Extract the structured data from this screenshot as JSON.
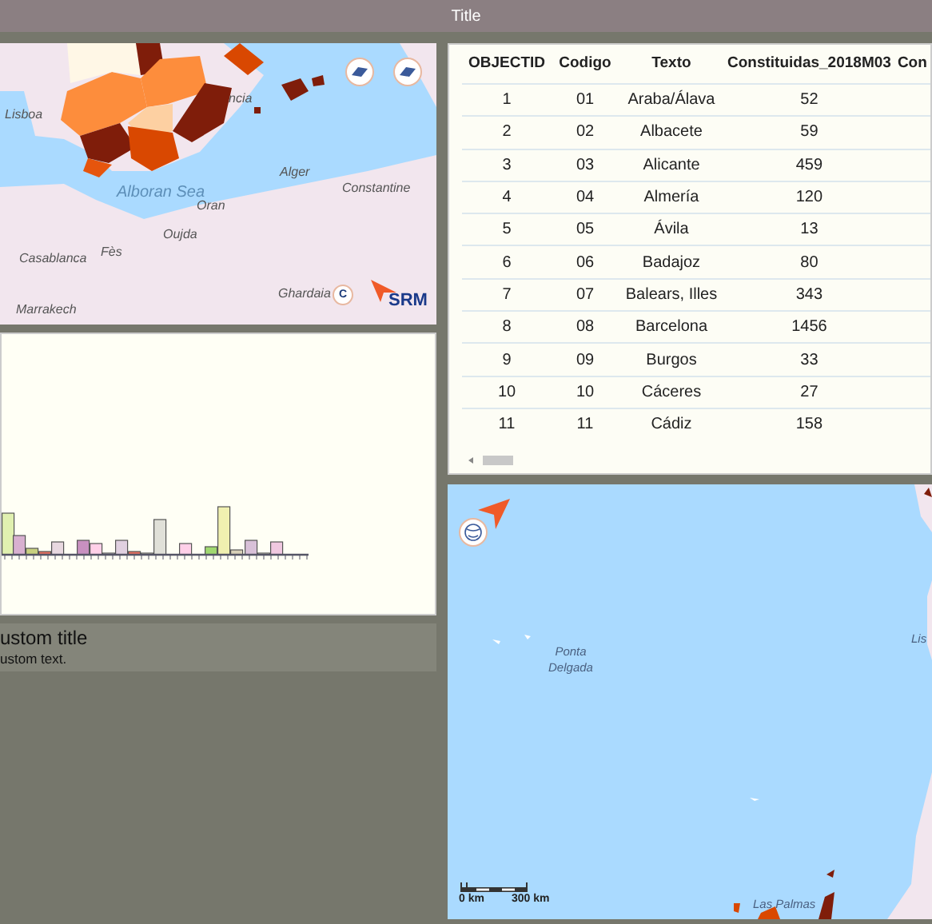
{
  "window": {
    "title": "Title"
  },
  "map_top": {
    "labels": [
      "Lisboa",
      "ncia",
      "Alger",
      "Constantine",
      "Alboran Sea",
      "Oran",
      "Oujda",
      "Fès",
      "Casablanca",
      "Ghardaia",
      "Marrakech"
    ],
    "logo_text": "SRM",
    "attribution_button": "C"
  },
  "info_panel": {
    "title": "ustom title",
    "text": "ustom text."
  },
  "table": {
    "columns": [
      "OBJECTID",
      "Codigo",
      "Texto",
      "Constituidas_2018M03",
      "Con"
    ],
    "rows": [
      [
        "1",
        "01",
        "Araba/Álava",
        "52"
      ],
      [
        "2",
        "02",
        "Albacete",
        "59"
      ],
      [
        "3",
        "03",
        "Alicante",
        "459"
      ],
      [
        "4",
        "04",
        "Almería",
        "120"
      ],
      [
        "5",
        "05",
        "Ávila",
        "13"
      ],
      [
        "6",
        "06",
        "Badajoz",
        "80"
      ],
      [
        "7",
        "07",
        "Balears, Illes",
        "343"
      ],
      [
        "8",
        "08",
        "Barcelona",
        "1456"
      ],
      [
        "9",
        "09",
        "Burgos",
        "33"
      ],
      [
        "10",
        "10",
        "Cáceres",
        "27"
      ],
      [
        "11",
        "11",
        "Cádiz",
        "158"
      ]
    ]
  },
  "map_bottom": {
    "labels": [
      "Ponta Delgada",
      "Lis",
      "Las Palmas"
    ],
    "scale_labels": [
      "0 km",
      "300 km"
    ]
  }
}
